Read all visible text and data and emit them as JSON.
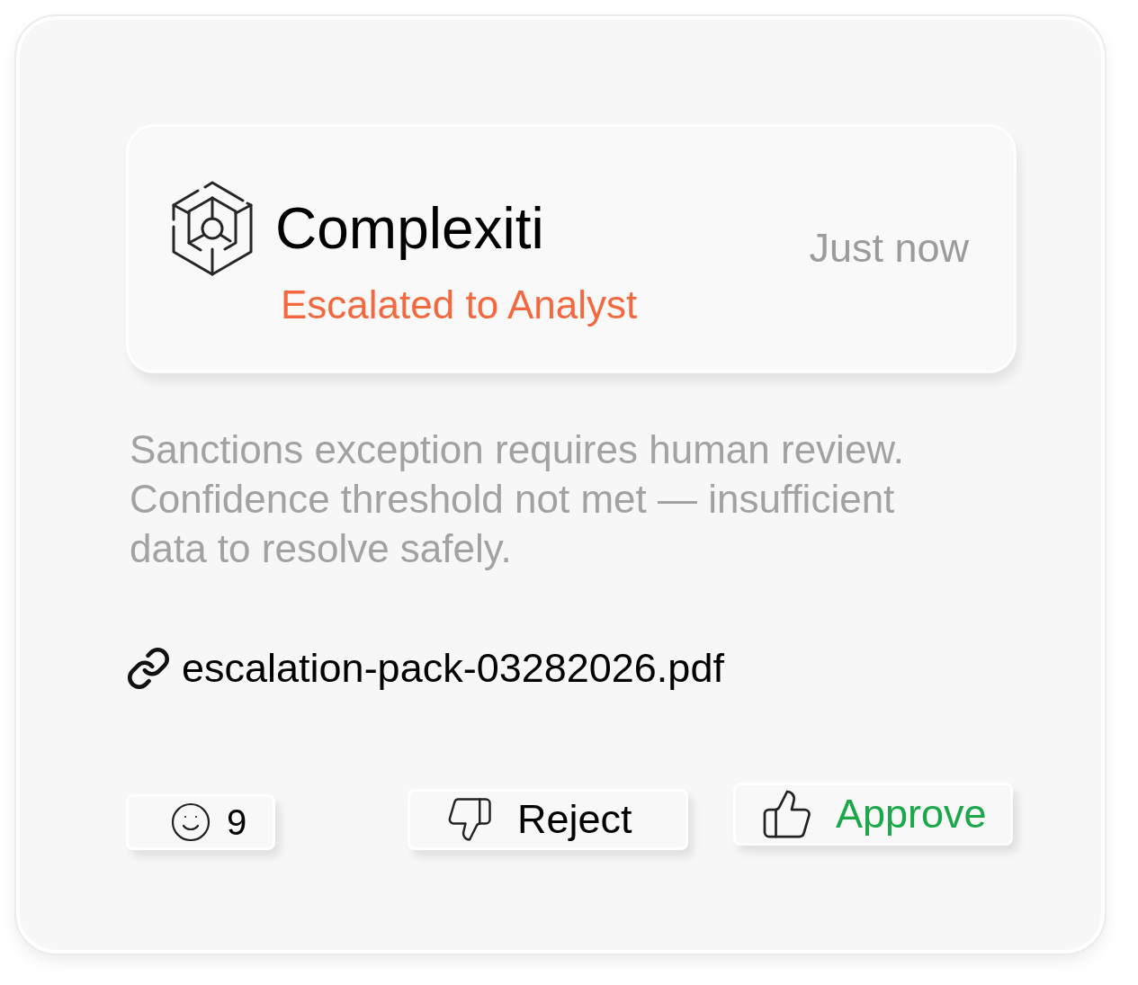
{
  "header": {
    "app_name": "Complexiti",
    "status": "Escalated to Analyst",
    "time": "Just now"
  },
  "message": "Sanctions exception requires human review. Confidence threshold not met — insufficient data to resolve safely.",
  "attachment": {
    "filename": "escalation-pack-03282026.pdf"
  },
  "actions": [
    {
      "kind": "reaction",
      "label": "9"
    },
    {
      "kind": "reject",
      "label": "Reject"
    },
    {
      "kind": "approve",
      "label": "Approve"
    }
  ]
}
